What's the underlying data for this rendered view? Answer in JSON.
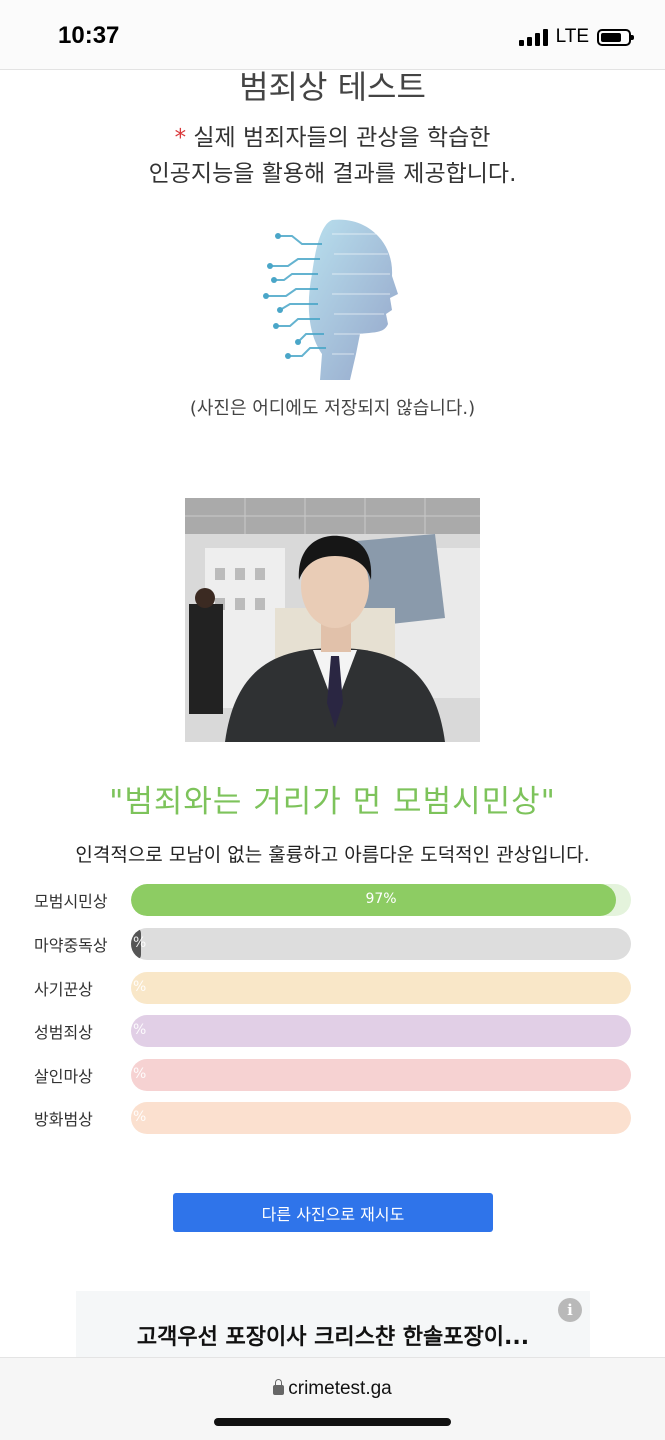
{
  "status": {
    "time": "10:37",
    "network": "LTE"
  },
  "header": {
    "title": "범죄상 테스트",
    "subtitle_asterisk": "*",
    "subtitle_line1": "실제 범죄자들의 관상을 학습한",
    "subtitle_line2": "인공지능을 활용해 결과를 제공합니다.",
    "privacy_note": "(사진은 어디에도 저장되지 않습니다.)"
  },
  "result": {
    "title": "\"범죄와는 거리가 먼 모범시민상\"",
    "description": "인격적으로 모남이 없는 훌륭하고 아름다운 도덕적인 관상입니다."
  },
  "bars": [
    {
      "label": "모범시민상",
      "percent": 97,
      "percent_text": "97%",
      "track_color": "#e4f3dc",
      "fill_color": "#8dcc63"
    },
    {
      "label": "마약중독상",
      "percent": 2,
      "percent_text": "%",
      "track_color": "#dddddd",
      "fill_color": "#555555"
    },
    {
      "label": "사기꾼상",
      "percent": 0,
      "percent_text": "%",
      "track_color": "#f9e7c8",
      "fill_color": "#f0c060"
    },
    {
      "label": "성범죄상",
      "percent": 0,
      "percent_text": "%",
      "track_color": "#e1cfe6",
      "fill_color": "#a277b6"
    },
    {
      "label": "살인마상",
      "percent": 0,
      "percent_text": "%",
      "track_color": "#f6d2d2",
      "fill_color": "#e06060"
    },
    {
      "label": "방화범상",
      "percent": 0,
      "percent_text": "%",
      "track_color": "#fbe0cf",
      "fill_color": "#f0a070"
    }
  ],
  "retry_button": "다른 사진으로 재시도",
  "ad": {
    "text": "고객우선 포장이사 크리스챤 한솔포장이...",
    "info_icon": "i"
  },
  "url_bar": {
    "url": "crimetest.ga"
  },
  "icons": [
    "signal-icon",
    "battery-icon",
    "ai-face-icon",
    "info-icon",
    "lock-icon"
  ]
}
